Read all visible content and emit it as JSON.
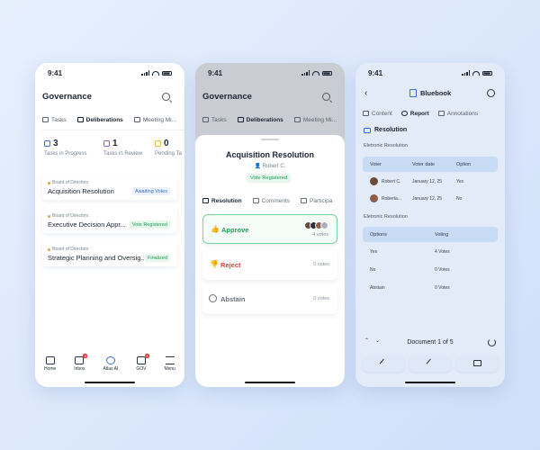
{
  "phone1": {
    "time": "9:41",
    "title": "Governance",
    "tabs": [
      "Tasks",
      "Deliberations",
      "Meeting Mi..."
    ],
    "stats": [
      {
        "num": "3",
        "label": "Tasks in Progress",
        "color": "#3b6fd8"
      },
      {
        "num": "1",
        "label": "Tasks in Review",
        "color": "#8a5cd6"
      },
      {
        "num": "0",
        "label": "Pending Ta",
        "color": "#e8b935"
      }
    ],
    "cards": [
      {
        "org": "Board of Directors",
        "name": "Acquisition Resolution",
        "badge": "Awaiting Votes",
        "badge_color": "#3b6fd8",
        "badge_bg": "#eaf1fd"
      },
      {
        "org": "Board of Directors",
        "name": "Executive Decision Appr...",
        "badge": "Vote Registered",
        "badge_color": "#1f9d57",
        "badge_bg": "#e7f7ee"
      },
      {
        "org": "Board of Directors",
        "name": "Strategic Planning and Oversig...",
        "badge": "Finalized",
        "badge_color": "#1f9d57",
        "badge_bg": "#e7f7ee"
      }
    ],
    "nav": [
      {
        "label": "Home",
        "icon": "home-icon",
        "badge": ""
      },
      {
        "label": "Inbox",
        "icon": "inbox-icon",
        "badge": "2"
      },
      {
        "label": "Atlas AI",
        "icon": "ai-icon",
        "badge": ""
      },
      {
        "label": "GOV",
        "icon": "gov-icon",
        "badge": "3"
      },
      {
        "label": "Menu",
        "icon": "menu-icon",
        "badge": ""
      }
    ]
  },
  "phone2": {
    "time": "9:41",
    "title": "Governance",
    "tabs": [
      "Tasks",
      "Deliberations",
      "Meeting Mi..."
    ],
    "sheet_title": "Acquisition Resolution",
    "author": "Robert C.",
    "status_pill": "Vote Registered",
    "tabs2": [
      "Resolution",
      "Comments",
      "Participa"
    ],
    "options": [
      {
        "label": "Approve",
        "count": "4 votes",
        "color": "#1f9d57"
      },
      {
        "label": "Reject",
        "count": "0 votes",
        "color": "#e03b3b"
      },
      {
        "label": "Abstain",
        "count": "0 votes",
        "color": "#6a717c"
      }
    ]
  },
  "phone3": {
    "time": "9:41",
    "title": "Bluebook",
    "tabs": [
      "Content",
      "Report",
      "Annotations"
    ],
    "section": "Resolution",
    "sub1": "Eletronic Resolution",
    "table1_headers": [
      "Voter",
      "Voter date",
      "Option"
    ],
    "table1_rows": [
      {
        "voter": "Robert C.",
        "date": "January 12, 25",
        "option": "Yes"
      },
      {
        "voter": "Roberta...",
        "date": "January 12, 25",
        "option": "No"
      }
    ],
    "sub2": "Eletronic Resolution",
    "table2_headers": [
      "Options",
      "Voting"
    ],
    "table2_rows": [
      {
        "option": "Yes",
        "voting": "4 Votes"
      },
      {
        "option": "No",
        "voting": "0 Votes"
      },
      {
        "option": "Abstain",
        "voting": "0 Votes"
      }
    ],
    "doc_label": "Document 1 of 5"
  }
}
